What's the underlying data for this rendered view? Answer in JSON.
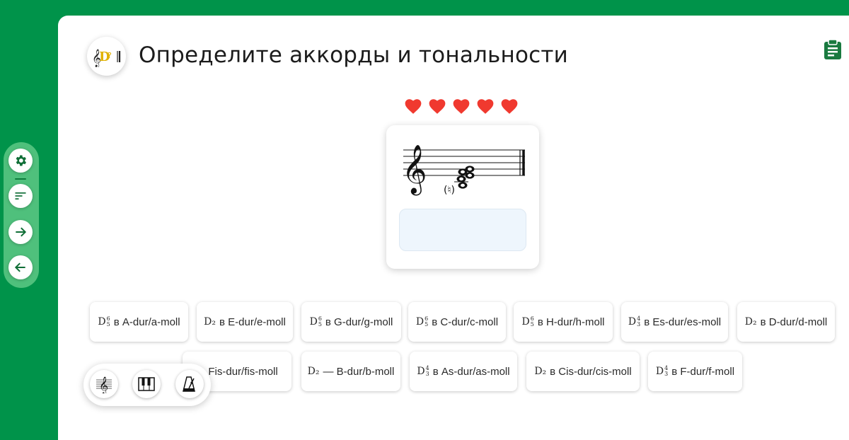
{
  "header": {
    "title": "Определите аккорды и тональности"
  },
  "lives": {
    "count": 5,
    "color": "#f0392f"
  },
  "colors": {
    "brand_green": "#00934a",
    "rail_green": "#4fc07c",
    "answer_box": "#eef6fd"
  },
  "side_rail": {
    "items": [
      {
        "icon": "gear-icon"
      },
      {
        "icon": "sort-icon"
      },
      {
        "icon": "arrow-right-icon"
      },
      {
        "icon": "arrow-left-icon"
      }
    ]
  },
  "options_row1": [
    {
      "sym": "D",
      "sup": "6",
      "sub": "5",
      "label": "в A-dur/a-moll"
    },
    {
      "sym": "D₂",
      "sup": "",
      "sub": "",
      "label": "в E-dur/e-moll"
    },
    {
      "sym": "D",
      "sup": "6",
      "sub": "5",
      "label": "в G-dur/g-moll"
    },
    {
      "sym": "D",
      "sup": "6",
      "sub": "5",
      "label": "в C-dur/c-moll"
    },
    {
      "sym": "D",
      "sup": "6",
      "sub": "5",
      "label": "в H-dur/h-moll"
    },
    {
      "sym": "D",
      "sup": "4",
      "sub": "3",
      "label": "в Es-dur/es-moll"
    },
    {
      "sym": "D₂",
      "sup": "",
      "sub": "",
      "label": "в D-dur/d-moll"
    }
  ],
  "options_row2": [
    {
      "sym": "",
      "sup": "",
      "sub": "",
      "label": "в Fis-dur/fis-moll"
    },
    {
      "sym": "D₂",
      "sup": "",
      "sub": "",
      "label": "— B-dur/b-moll"
    },
    {
      "sym": "D",
      "sup": "4",
      "sub": "3",
      "label": "в As-dur/as-moll"
    },
    {
      "sym": "D₂",
      "sup": "",
      "sub": "",
      "label": "в Cis-dur/cis-moll"
    },
    {
      "sym": "D",
      "sup": "4",
      "sub": "3",
      "label": "в F-dur/f-moll"
    }
  ],
  "tools": [
    {
      "icon": "treble-clef-icon"
    },
    {
      "icon": "piano-icon"
    },
    {
      "icon": "metronome-icon"
    }
  ]
}
